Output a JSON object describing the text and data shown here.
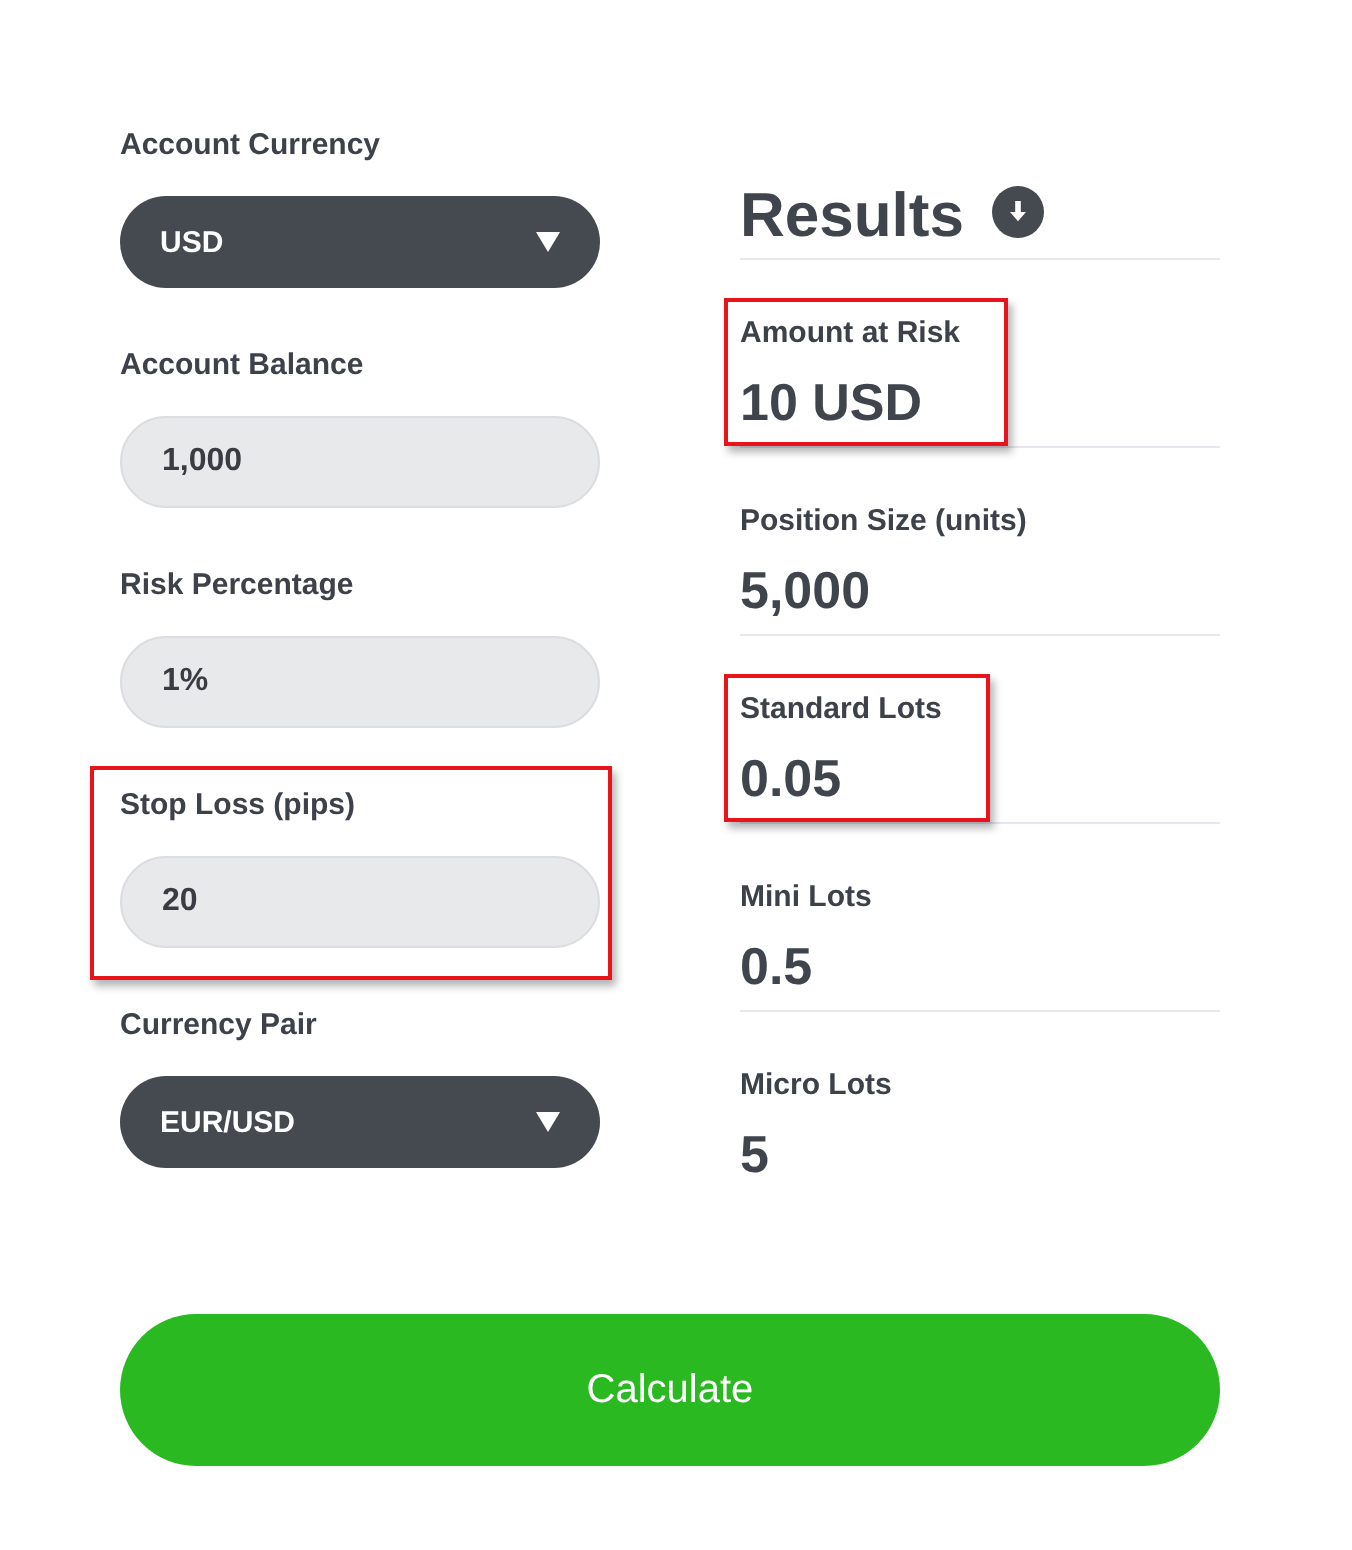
{
  "form": {
    "fields": [
      {
        "kind": "select",
        "label": "Account Currency",
        "value": "USD",
        "highlighted": false
      },
      {
        "kind": "input",
        "label": "Account Balance",
        "value": "1,000",
        "highlighted": false
      },
      {
        "kind": "input",
        "label": "Risk Percentage",
        "value": "1%",
        "highlighted": false
      },
      {
        "kind": "input",
        "label": "Stop Loss (pips)",
        "value": "20",
        "highlighted": true
      },
      {
        "kind": "select",
        "label": "Currency Pair",
        "value": "EUR/USD",
        "highlighted": false
      }
    ]
  },
  "results": {
    "title": "Results",
    "items": [
      {
        "label": "Amount at Risk",
        "value": "10 USD",
        "highlighted": true
      },
      {
        "label": "Position Size (units)",
        "value": "5,000",
        "highlighted": false
      },
      {
        "label": "Standard Lots",
        "value": "0.05",
        "highlighted": true
      },
      {
        "label": "Mini Lots",
        "value": "0.5",
        "highlighted": false
      },
      {
        "label": "Micro Lots",
        "value": "5",
        "highlighted": false
      }
    ]
  },
  "calculate_button": {
    "label": "Calculate"
  }
}
